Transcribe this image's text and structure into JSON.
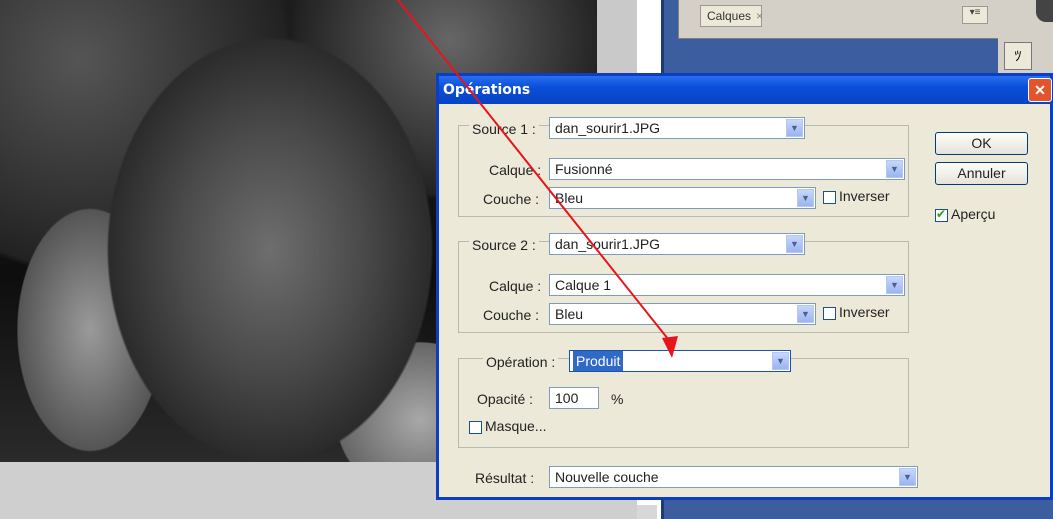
{
  "layers_panel": {
    "tab_label": "Calques",
    "tab_close": "×",
    "menu_glyph": "▾≡",
    "side_icon": "ﾂ"
  },
  "dialog": {
    "title": "Opérations",
    "close_glyph": "✕",
    "source1": {
      "legend_label": "Source 1 :",
      "file": "dan_sourir1.JPG",
      "calque_label": "Calque :",
      "calque_value": "Fusionné",
      "couche_label": "Couche :",
      "couche_value": "Bleu",
      "inverser_label": "Inverser",
      "inverser_checked": false
    },
    "source2": {
      "legend_label": "Source 2 :",
      "file": "dan_sourir1.JPG",
      "calque_label": "Calque :",
      "calque_value": "Calque 1",
      "couche_label": "Couche :",
      "couche_value": "Bleu",
      "inverser_label": "Inverser",
      "inverser_checked": false
    },
    "operation": {
      "legend_label": "Opération :",
      "value": "Produit",
      "opacite_label": "Opacité :",
      "opacite_value": "100",
      "opacite_unit": "%",
      "masque_label": "Masque...",
      "masque_checked": false
    },
    "resultat": {
      "label": "Résultat :",
      "value": "Nouvelle couche"
    },
    "buttons": {
      "ok": "OK",
      "annuler": "Annuler"
    },
    "apercu": {
      "label": "Aperçu",
      "checked": true
    }
  },
  "colors": {
    "annotation_arrow": "#e8141b",
    "title_bar": "#0a4fd8",
    "dialog_bg": "#ece9d8"
  }
}
